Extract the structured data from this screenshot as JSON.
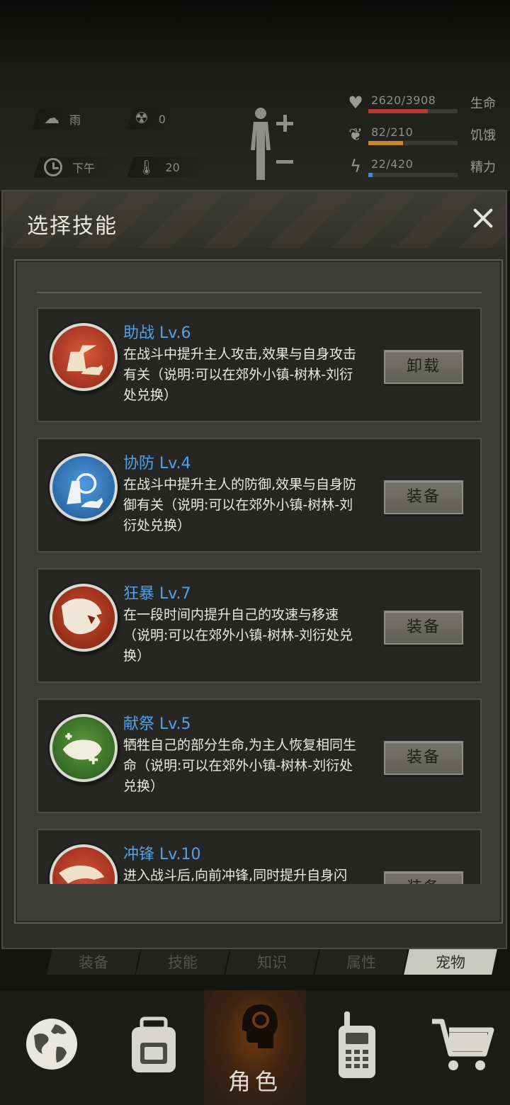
{
  "status": {
    "weather": "雨",
    "radiation": "0",
    "time_of_day": "下午",
    "temperature": "20"
  },
  "vitals": [
    {
      "label": "生命",
      "value": "2620/3908",
      "fraction": 0.67,
      "color": "#b23a2e",
      "icon": "heart-icon"
    },
    {
      "label": "饥饿",
      "value": "82/210",
      "fraction": 0.39,
      "color": "#c8882c",
      "icon": "stomach-icon"
    },
    {
      "label": "精力",
      "value": "22/420",
      "fraction": 0.05,
      "color": "#3f8fd0",
      "icon": "energy-icon"
    }
  ],
  "modal": {
    "title": "选择技能",
    "close_icon": "close-icon"
  },
  "skills": [
    {
      "name": "助战 Lv.6",
      "desc": "在战斗中提升主人攻击,效果与自身攻击有关（说明:可以在郊外小镇-树林-刘衍处兑换）",
      "button": "卸载",
      "icon": "hunter-dog-icon",
      "color": "#b8331f"
    },
    {
      "name": "协防 Lv.4",
      "desc": "在战斗中提升主人的防御,效果与自身防御有关（说明:可以在郊外小镇-树林-刘衍处兑换）",
      "button": "装备",
      "icon": "shield-dog-icon",
      "color": "#2f74b8"
    },
    {
      "name": "狂暴 Lv.7",
      "desc": "在一段时间内提升自己的攻速与移速（说明:可以在郊外小镇-树林-刘衍处兑换）",
      "button": "装备",
      "icon": "roaring-beast-icon",
      "color": "#a8301c"
    },
    {
      "name": "献祭 Lv.5",
      "desc": "牺牲自己的部分生命,为主人恢复相同生命（说明:可以在郊外小镇-树林-刘衍处兑换）",
      "button": "装备",
      "icon": "sacrifice-paw-icon",
      "color": "#3c7a2a"
    },
    {
      "name": "冲锋 Lv.10",
      "desc": "进入战斗后,向前冲锋,同时提升自身闪",
      "button": "装备",
      "icon": "charge-beast-icon",
      "color": "#b8331f"
    }
  ],
  "tabs": [
    {
      "label": "装备",
      "active": false
    },
    {
      "label": "技能",
      "active": false
    },
    {
      "label": "知识",
      "active": false
    },
    {
      "label": "属性",
      "active": false
    },
    {
      "label": "宠物",
      "active": true
    }
  ],
  "nav": [
    {
      "name": "world-map",
      "icon": "globe-icon",
      "label": ""
    },
    {
      "name": "backpack",
      "icon": "backpack-icon",
      "label": ""
    },
    {
      "name": "character",
      "icon": "head-icon",
      "label": "角色",
      "active": true
    },
    {
      "name": "radio",
      "icon": "walkie-talkie-icon",
      "label": ""
    },
    {
      "name": "shop",
      "icon": "cart-icon",
      "label": ""
    }
  ]
}
